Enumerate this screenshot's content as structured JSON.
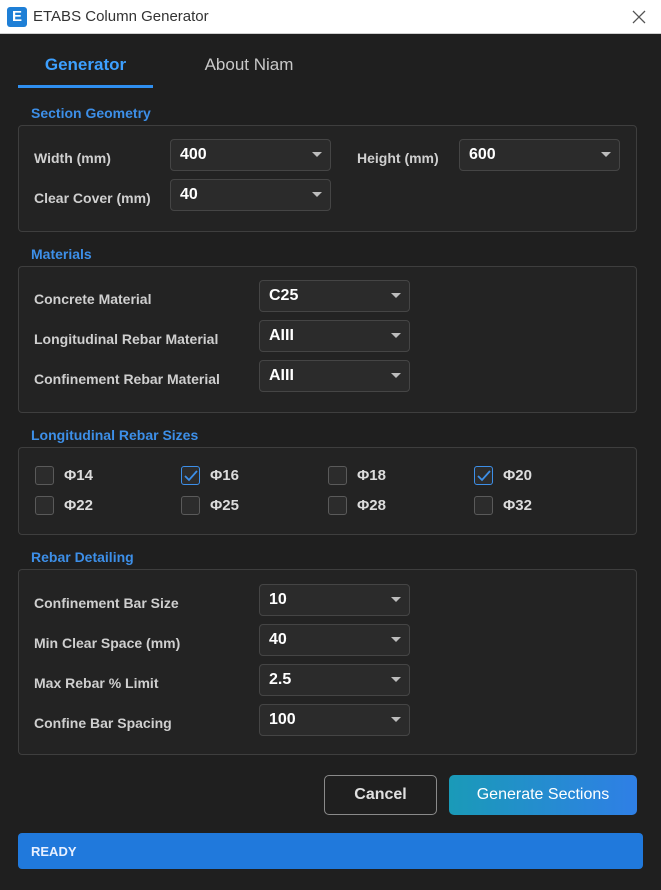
{
  "window": {
    "title": "ETABS Column Generator",
    "icon_letter": "E"
  },
  "tabs": [
    {
      "label": "Generator",
      "active": true
    },
    {
      "label": "About Niam",
      "active": false
    }
  ],
  "section_geometry": {
    "title": "Section Geometry",
    "width_label": "Width (mm)",
    "width_value": "400",
    "height_label": "Height (mm)",
    "height_value": "600",
    "cover_label": "Clear Cover (mm)",
    "cover_value": "40"
  },
  "materials": {
    "title": "Materials",
    "concrete_label": "Concrete Material",
    "concrete_value": "C25",
    "long_label": "Longitudinal Rebar Material",
    "long_value": "AIII",
    "conf_label": "Confinement Rebar Material",
    "conf_value": "AIII"
  },
  "rebar_sizes": {
    "title": "Longitudinal Rebar Sizes",
    "items": [
      {
        "label": "Φ14",
        "checked": false
      },
      {
        "label": "Φ16",
        "checked": true
      },
      {
        "label": "Φ18",
        "checked": false
      },
      {
        "label": "Φ20",
        "checked": true
      },
      {
        "label": "Φ22",
        "checked": false
      },
      {
        "label": "Φ25",
        "checked": false
      },
      {
        "label": "Φ28",
        "checked": false
      },
      {
        "label": "Φ32",
        "checked": false
      }
    ]
  },
  "detailing": {
    "title": "Rebar Detailing",
    "conf_bar_label": "Confinement Bar Size",
    "conf_bar_value": "10",
    "min_space_label": "Min Clear Space (mm)",
    "min_space_value": "40",
    "max_rebar_label": "Max Rebar % Limit",
    "max_rebar_value": "2.5",
    "spacing_label": "Confine Bar Spacing",
    "spacing_value": "100"
  },
  "buttons": {
    "cancel": "Cancel",
    "generate": "Generate Sections"
  },
  "status": {
    "text": "READY"
  },
  "colors": {
    "accent": "#3d8fe8",
    "background": "#1f1f1f",
    "status_bar": "#2079dc"
  }
}
